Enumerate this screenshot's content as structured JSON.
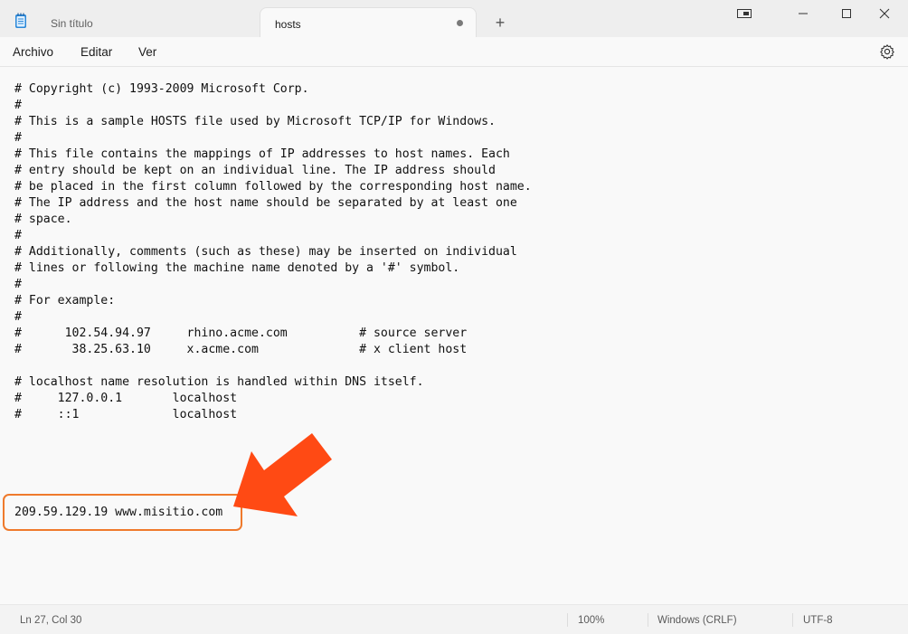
{
  "tabs": [
    {
      "label": "Sin título"
    },
    {
      "label": "hosts"
    }
  ],
  "new_tab_symbol": "+",
  "window_controls": [
    "restore-compact-icon",
    "minimize-icon",
    "maximize-icon",
    "close-icon"
  ],
  "menu": {
    "items": [
      {
        "label": "Archivo"
      },
      {
        "label": "Editar"
      },
      {
        "label": "Ver"
      }
    ],
    "settings_icon": "gear-icon"
  },
  "editor": {
    "lines": [
      "# Copyright (c) 1993-2009 Microsoft Corp.",
      "#",
      "# This is a sample HOSTS file used by Microsoft TCP/IP for Windows.",
      "#",
      "# This file contains the mappings of IP addresses to host names. Each",
      "# entry should be kept on an individual line. The IP address should",
      "# be placed in the first column followed by the corresponding host name.",
      "# The IP address and the host name should be separated by at least one",
      "# space.",
      "#",
      "# Additionally, comments (such as these) may be inserted on individual",
      "# lines or following the machine name denoted by a '#' symbol.",
      "#",
      "# For example:",
      "#",
      "#      102.54.94.97     rhino.acme.com          # source server",
      "#       38.25.63.10     x.acme.com              # x client host",
      "",
      "# localhost name resolution is handled within DNS itself.",
      "#     127.0.0.1       localhost",
      "#     ::1             localhost",
      "",
      "",
      "",
      "",
      "",
      "209.59.129.19 www.misitio.com"
    ],
    "highlight_color": "#ef7a2c",
    "arrow_color": "#ff4a14"
  },
  "status": {
    "position": "Ln 27, Col 30",
    "zoom": "100%",
    "line_ending": "Windows (CRLF)",
    "encoding": "UTF-8"
  }
}
